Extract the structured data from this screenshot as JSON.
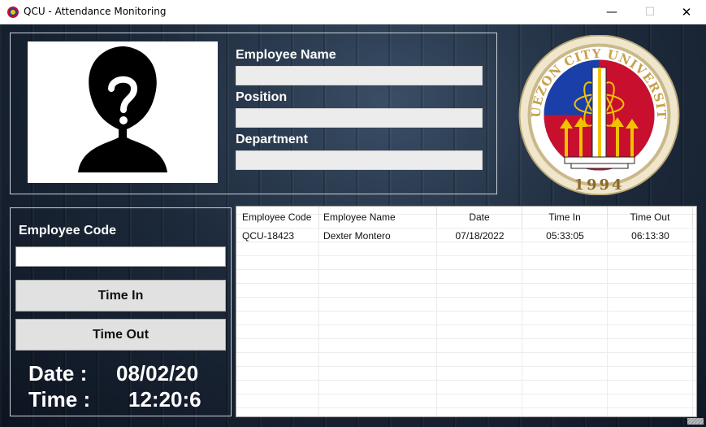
{
  "window": {
    "title": "QCU - Attendance Monitoring",
    "minimize_glyph": "—",
    "maximize_glyph": "☐",
    "close_glyph": "✕"
  },
  "employee_info": {
    "name_label": "Employee Name",
    "name_value": "",
    "position_label": "Position",
    "position_value": "",
    "department_label": "Department",
    "department_value": ""
  },
  "logo": {
    "university_text": "QUEZON CITY UNIVERSITY",
    "year": "1994"
  },
  "attendance": {
    "code_label": "Employee Code",
    "code_value": "",
    "time_in_label": "Time In",
    "time_out_label": "Time Out",
    "date_label": "Date :",
    "date_value": "08/02/20",
    "time_label": "Time :",
    "time_value": "12:20:6"
  },
  "records_table": {
    "columns": [
      "Employee Code",
      "Employee Name",
      "Date",
      "Time In",
      "Time Out"
    ],
    "rows": [
      [
        "QCU-18423",
        "Dexter Montero",
        "07/18/2022",
        "05:33:05",
        "06:13:30"
      ]
    ]
  },
  "colors": {
    "panel_border": "#c9d1da",
    "background_dark": "#1d2a3b",
    "logo_red": "#c8102e",
    "logo_blue": "#1b3fa8",
    "logo_yellow": "#f2c200",
    "logo_rim": "#d8c9a0"
  }
}
